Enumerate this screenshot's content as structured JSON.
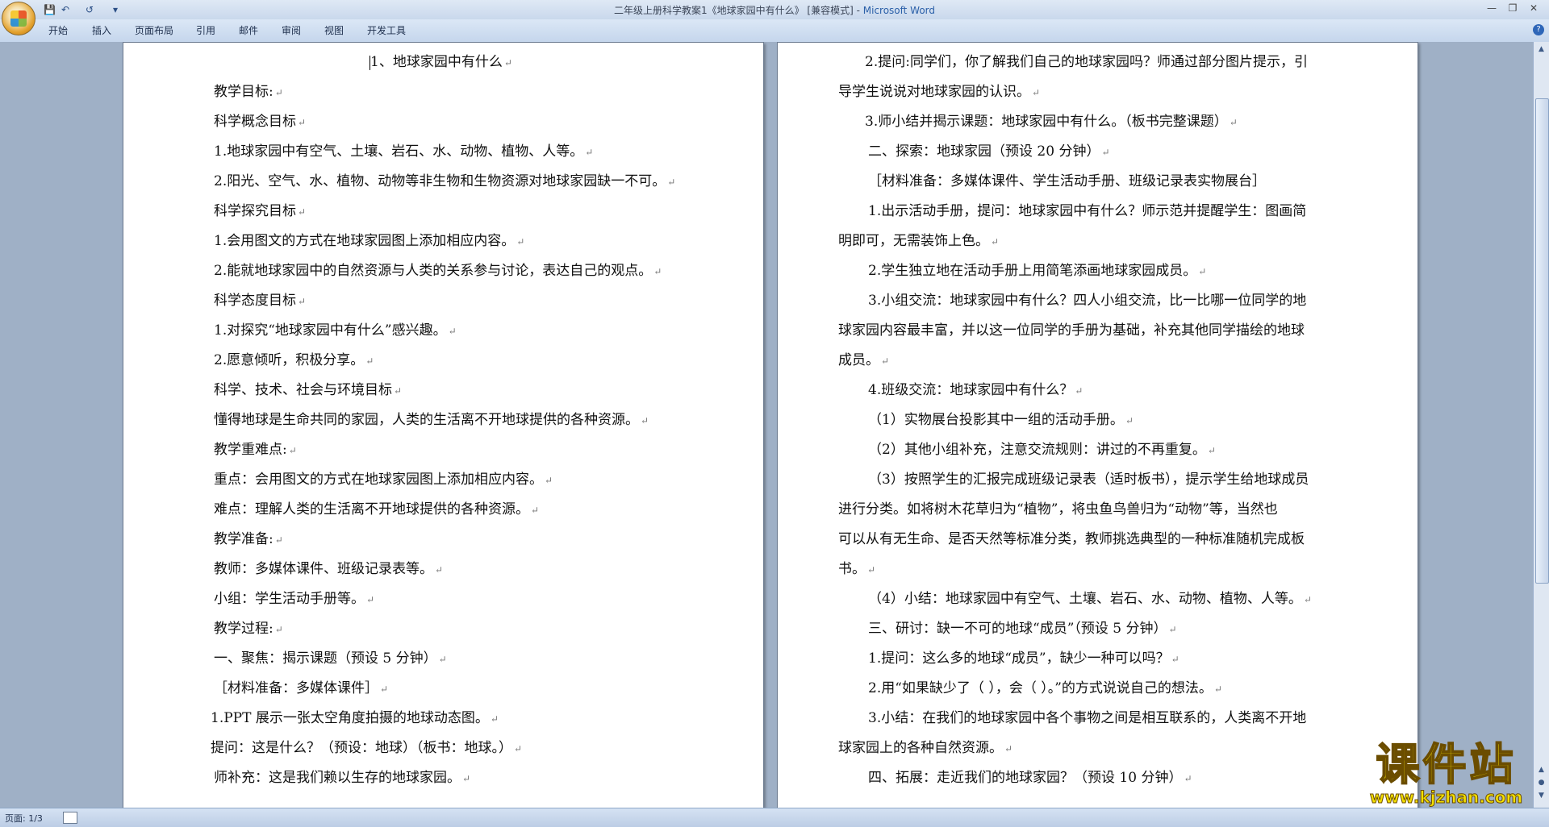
{
  "window": {
    "title": "二年级上册科学教案1《地球家园中有什么》 [兼容模式]",
    "app_name": "Microsoft Word"
  },
  "ribbon_tabs": [
    "开始",
    "插入",
    "页面布局",
    "引用",
    "邮件",
    "审阅",
    "视图",
    "开发工具"
  ],
  "status": {
    "page": "页面: 1/3"
  },
  "watermark": {
    "text": "课件站",
    "url": "www.kjzhan.com"
  },
  "left_page": [
    "1、地球家园中有什么",
    "教学目标:",
    "科学概念目标",
    "1.地球家园中有空气、土壤、岩石、水、动物、植物、人等。",
    "2.阳光、空气、水、植物、动物等非生物和生物资源对地球家园缺一不可。",
    "科学探究目标",
    "1.会用图文的方式在地球家园图上添加相应内容。",
    "2.能就地球家园中的自然资源与人类的关系参与讨论，表达自己的观点。",
    "科学态度目标",
    "1.对探究“地球家园中有什么”感兴趣。",
    "2.愿意倾听，积极分享。",
    "科学、技术、社会与环境目标",
    "懂得地球是生命共同的家园，人类的生活离不开地球提供的各种资源。",
    "教学重难点:",
    "重点：会用图文的方式在地球家园图上添加相应内容。",
    "难点：理解人类的生活离不开地球提供的各种资源。",
    "教学准备:",
    "教师：多媒体课件、班级记录表等。",
    "小组：学生活动手册等。",
    "教学过程:",
    "一、聚焦：揭示课题（预设 5 分钟）",
    "［材料准备：多媒体课件］",
    "1.PPT 展示一张太空角度拍摄的地球动态图。",
    "提问：这是什么？（预设：地球）（板书：地球。）",
    "师补充：这是我们赖以生存的地球家园。"
  ],
  "right_page": [
    "2.提问:同学们，你了解我们自己的地球家园吗？师通过部分图片提示，引",
    "导学生说说对地球家园的认识。",
    "3.师小结并揭示课题：地球家园中有什么。（板书完整课题）",
    "二、探索：地球家园（预设 20 分钟）",
    "［材料准备：多媒体课件、学生活动手册、班级记录表实物展台］",
    "1.出示活动手册，提问：地球家园中有什么？师示范并提醒学生：图画简",
    "明即可，无需装饰上色。",
    "2.学生独立地在活动手册上用简笔添画地球家园成员。",
    "3.小组交流：地球家园中有什么？四人小组交流，比一比哪一位同学的地",
    "球家园内容最丰富，并以这一位同学的手册为基础，补充其他同学描绘的地球",
    "成员。",
    "4.班级交流：地球家园中有什么？",
    "（1）实物展台投影其中一组的活动手册。",
    "（2）其他小组补充，注意交流规则：讲过的不再重复。",
    "（3）按照学生的汇报完成班级记录表（适时板书），提示学生给地球成员",
    "进行分类。如将树木花草归为“植物”，将虫鱼鸟兽归为“动物”等，当然也",
    "可以从有无生命、是否天然等标准分类，教师挑选典型的一种标准随机完成板",
    "书。",
    "（4）小结：地球家园中有空气、土壤、岩石、水、动物、植物、人等。",
    "三、研讨：缺一不可的地球“成员”（预设 5 分钟）",
    "1.提问：这么多的地球“成员”，缺少一种可以吗？",
    "2.用“如果缺少了（ ），会（ ）。”的方式说说自己的想法。",
    "3.小结：在我们的地球家园中各个事物之间是相互联系的，人类离不开地",
    "球家园上的各种自然资源。",
    "四、拓展：走近我们的地球家园？（预设 10 分钟）"
  ],
  "icons": {
    "office_button": "office-logo-icon",
    "save": "save-icon",
    "undo": "undo-icon",
    "redo": "redo-icon",
    "help": "help-icon",
    "paragraph_mark": "paragraph-mark-icon"
  }
}
